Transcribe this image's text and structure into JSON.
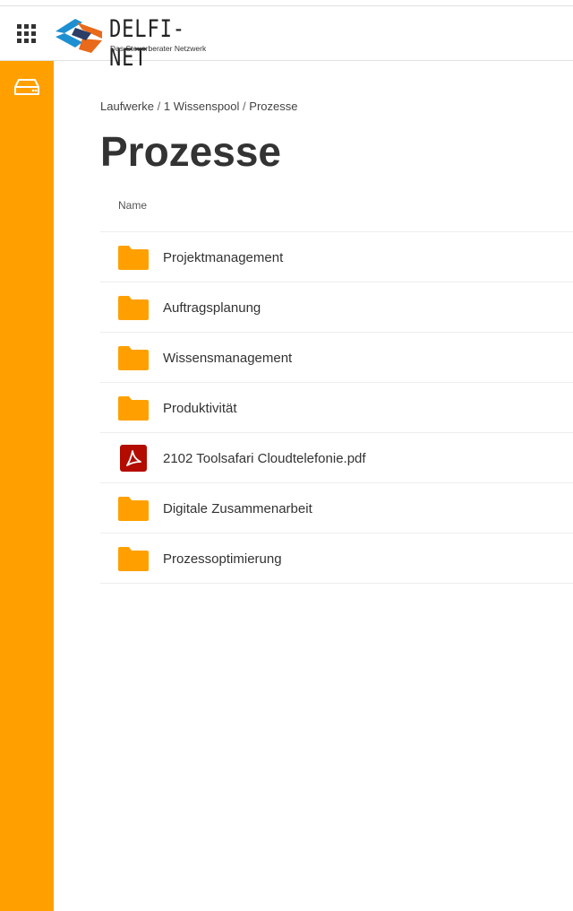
{
  "header": {
    "apps_icon": "apps-grid-icon",
    "logo": {
      "name": "DELFI-NET",
      "tagline": "Das Steuerberater Netzwerk"
    }
  },
  "sidebar": {
    "drive_icon": "drive-icon",
    "accent": "#ffa000"
  },
  "breadcrumb": {
    "items": [
      "Laufwerke",
      "1 Wissenspool",
      "Prozesse"
    ],
    "separator": "/"
  },
  "page": {
    "title": "Prozesse"
  },
  "table": {
    "column_name": "Name",
    "rows": [
      {
        "type": "folder",
        "icon": "folder-icon",
        "name": "Projektmanagement"
      },
      {
        "type": "folder",
        "icon": "folder-icon",
        "name": "Auftragsplanung"
      },
      {
        "type": "folder",
        "icon": "folder-icon",
        "name": "Wissensmanagement"
      },
      {
        "type": "folder",
        "icon": "folder-icon",
        "name": "Produktivität"
      },
      {
        "type": "pdf",
        "icon": "pdf-icon",
        "name": "2102 Toolsafari Cloudtelefonie.pdf"
      },
      {
        "type": "folder",
        "icon": "folder-icon",
        "name": "Digitale Zusammenarbeit"
      },
      {
        "type": "folder",
        "icon": "folder-icon",
        "name": "Prozessoptimierung"
      }
    ]
  },
  "colors": {
    "folder": "#ffa000",
    "pdf": "#b30b00",
    "text": "#333333"
  }
}
